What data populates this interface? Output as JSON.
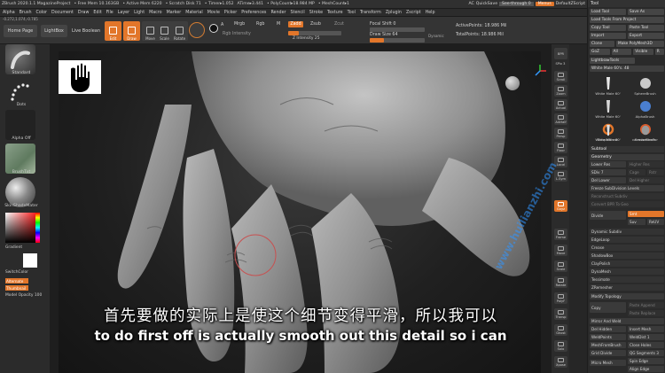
{
  "titlebar": {
    "app": "ZBrush 2020.1.1 MagazineProject",
    "free_mem": "• Free Mem 10.163GB",
    "active_mem": "• Active Mem 6220",
    "scratch": "• Scratch Disk 71",
    "timer": "• Timer▸1.052",
    "atime": "ATime▸3.441",
    "polycount": "• PolyCount▸18.984 MP",
    "meshcount": "• MeshCount▸1",
    "ac": "AC",
    "quicksave": "QuickSave",
    "seethrough": "See-through 0",
    "menus": "Menus",
    "script": "DefaultZScript"
  },
  "menubar": {
    "items": [
      "Alpha",
      "Brush",
      "Color",
      "Document",
      "Draw",
      "Edit",
      "File",
      "Layer",
      "Light",
      "Macro",
      "Marker",
      "Material",
      "Movie",
      "Picker",
      "Preferences",
      "Render",
      "Stencil",
      "Stroke",
      "Texture",
      "Tool",
      "Transform",
      "Zplugin",
      "Zscript",
      "Help"
    ],
    "coords": "-0.272,1.074,-0.785"
  },
  "shelf": {
    "home_page": "Home Page",
    "lightbox": "LightBox",
    "live_boolean": "Live Boolean",
    "tools": [
      "Edit",
      "Draw",
      "Move",
      "Scale",
      "Rotate"
    ],
    "a_label": "A",
    "mrgb": "Mrgb",
    "rgb": "Rgb",
    "m": "M",
    "zadd": "Zadd",
    "zsub": "Zsub",
    "zcut": "Zcut",
    "rgb_intensity": "Rgb Intensity",
    "z_intensity": "Z Intensity 25",
    "focal_shift": "Focal Shift 0",
    "draw_size": "Draw Size 64",
    "dynamic": "Dynamic",
    "active_points": "ActivePoints: 18.986 Mil",
    "total_points": "TotalPoints: 18.986 Mil"
  },
  "lefttray": {
    "standard": "Standard",
    "dots": "Dots",
    "alpha_off": "Alpha Off",
    "texture_off": "BrushTxt",
    "matcap": "SkinShadeMater",
    "gradient": "Gradient",
    "switch_color": "SwitchColor",
    "alternate": "Alternate",
    "thumbnail": "Thumbnail",
    "model_opacity": "Model Opacity 100"
  },
  "rightstrip": {
    "labels": [
      "BPR",
      "SPix 3",
      "Scroll",
      "Zoom",
      "Actual",
      "AAHalf",
      "Persp",
      "Floor",
      "Local",
      "L.Sym",
      "Gxyz",
      "Frame",
      "Move",
      "Scale",
      "Rotate",
      "PolyF",
      "Transp",
      "Ghost",
      "Solo",
      "Xpose"
    ]
  },
  "rpanel": {
    "header": "Tool",
    "load_tool": "Load Tool",
    "save_as": "Save As",
    "load_tools_from_project": "Load Tools From Project",
    "copy_tool": "Copy Tool",
    "paste_tool": "Paste Tool",
    "import": "Import",
    "export": "Export",
    "clone": "Clone",
    "make_polymesh": "Make PolyMesh3D",
    "goz": "GoZ",
    "all": "All",
    "visible": "Visible",
    "r": "R",
    "lightbox_tools": "Lightbox▸Tools",
    "white_male": "White Male 60's. 48",
    "brushes": [
      "White Male 60'",
      "SphereBrush",
      "White Male 60'",
      "AlphaBrush",
      "SimpleBrush",
      "EraserBrush",
      "White Male 60'",
      "cavedwellerFor"
    ],
    "subtool": "Subtool",
    "geometry": "Geometry",
    "lower_res": "Lower Res",
    "higher_res": "Higher Res",
    "sdiv": "SDiv 7",
    "cage": "Cage",
    "rstr": "Rstr",
    "del_lower": "Del Lower",
    "del_higher": "Del Higher",
    "freeze_subdiv": "Freeze SubDivision Levels",
    "reconstruct": "Reconstruct Subdiv",
    "convert_bpr": "Convert BPR To Geo",
    "divide": "Divide",
    "smt": "Smt",
    "suv": "Suv",
    "reuv": "ReUV",
    "dynamic_subdiv": "Dynamic Subdiv",
    "edgeloop": "EdgeLoop",
    "crease": "Crease",
    "shadowbox": "ShadowBox",
    "claypolish": "ClayPolish",
    "dynamesh": "DynaMesh",
    "tessimate": "Tessimate",
    "zremesher": "ZRemesher",
    "modify_topology": "Modify Topology",
    "copy": "Copy",
    "paste_append": "Paste Append",
    "paste_replace": "Paste Replace",
    "mirror_weld": "Mirror And Weld",
    "delete_hidden": "Del Hidden",
    "insert_mesh": "Insert Mesh",
    "weld_points": "WeldPoints",
    "weld_dist": "WeldDist 1",
    "mesh_from_brush": "MeshFromBrush",
    "close_holes": "Close Holes",
    "grid_divide": "Grid Divide",
    "qgrid": "QG Segments 3",
    "micro_mesh": "Micro Mesh",
    "spin_edge": "Spin Edge",
    "align_edge": "Align Edge"
  },
  "subtitles": {
    "chinese": "首先要做的实际上是使这个细节变得平滑，所以我可以",
    "english": "to do first off is actually smooth out this detail so i can"
  },
  "watermark": "www.huilianzhi.com",
  "colors": {
    "accent": "#e2762a",
    "panel": "#2a2a2a",
    "viewport": "#1e1e1e"
  }
}
